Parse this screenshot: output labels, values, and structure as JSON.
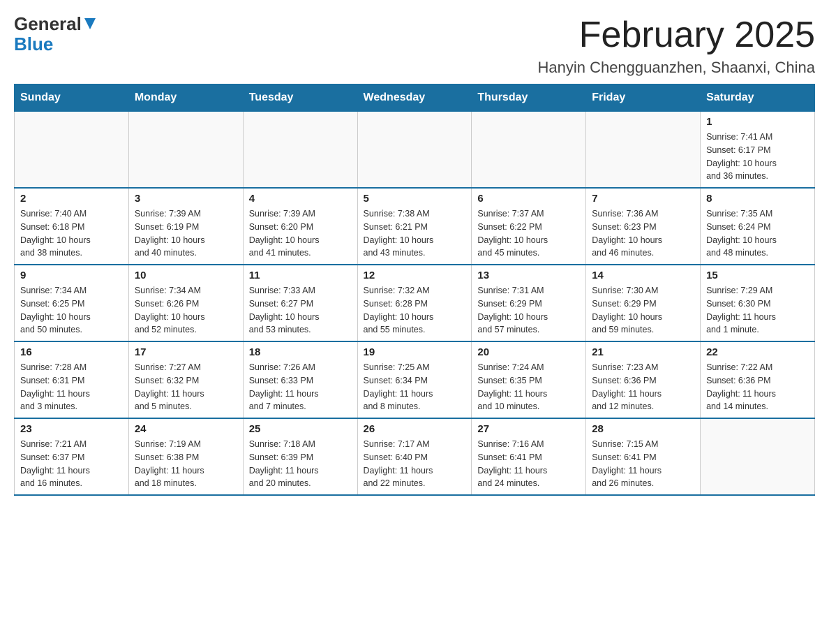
{
  "header": {
    "logo": {
      "general": "General",
      "blue": "Blue"
    },
    "title": "February 2025",
    "subtitle": "Hanyin Chengguanzhen, Shaanxi, China"
  },
  "calendar": {
    "days_of_week": [
      "Sunday",
      "Monday",
      "Tuesday",
      "Wednesday",
      "Thursday",
      "Friday",
      "Saturday"
    ],
    "weeks": [
      [
        {
          "day": "",
          "info": ""
        },
        {
          "day": "",
          "info": ""
        },
        {
          "day": "",
          "info": ""
        },
        {
          "day": "",
          "info": ""
        },
        {
          "day": "",
          "info": ""
        },
        {
          "day": "",
          "info": ""
        },
        {
          "day": "1",
          "info": "Sunrise: 7:41 AM\nSunset: 6:17 PM\nDaylight: 10 hours\nand 36 minutes."
        }
      ],
      [
        {
          "day": "2",
          "info": "Sunrise: 7:40 AM\nSunset: 6:18 PM\nDaylight: 10 hours\nand 38 minutes."
        },
        {
          "day": "3",
          "info": "Sunrise: 7:39 AM\nSunset: 6:19 PM\nDaylight: 10 hours\nand 40 minutes."
        },
        {
          "day": "4",
          "info": "Sunrise: 7:39 AM\nSunset: 6:20 PM\nDaylight: 10 hours\nand 41 minutes."
        },
        {
          "day": "5",
          "info": "Sunrise: 7:38 AM\nSunset: 6:21 PM\nDaylight: 10 hours\nand 43 minutes."
        },
        {
          "day": "6",
          "info": "Sunrise: 7:37 AM\nSunset: 6:22 PM\nDaylight: 10 hours\nand 45 minutes."
        },
        {
          "day": "7",
          "info": "Sunrise: 7:36 AM\nSunset: 6:23 PM\nDaylight: 10 hours\nand 46 minutes."
        },
        {
          "day": "8",
          "info": "Sunrise: 7:35 AM\nSunset: 6:24 PM\nDaylight: 10 hours\nand 48 minutes."
        }
      ],
      [
        {
          "day": "9",
          "info": "Sunrise: 7:34 AM\nSunset: 6:25 PM\nDaylight: 10 hours\nand 50 minutes."
        },
        {
          "day": "10",
          "info": "Sunrise: 7:34 AM\nSunset: 6:26 PM\nDaylight: 10 hours\nand 52 minutes."
        },
        {
          "day": "11",
          "info": "Sunrise: 7:33 AM\nSunset: 6:27 PM\nDaylight: 10 hours\nand 53 minutes."
        },
        {
          "day": "12",
          "info": "Sunrise: 7:32 AM\nSunset: 6:28 PM\nDaylight: 10 hours\nand 55 minutes."
        },
        {
          "day": "13",
          "info": "Sunrise: 7:31 AM\nSunset: 6:29 PM\nDaylight: 10 hours\nand 57 minutes."
        },
        {
          "day": "14",
          "info": "Sunrise: 7:30 AM\nSunset: 6:29 PM\nDaylight: 10 hours\nand 59 minutes."
        },
        {
          "day": "15",
          "info": "Sunrise: 7:29 AM\nSunset: 6:30 PM\nDaylight: 11 hours\nand 1 minute."
        }
      ],
      [
        {
          "day": "16",
          "info": "Sunrise: 7:28 AM\nSunset: 6:31 PM\nDaylight: 11 hours\nand 3 minutes."
        },
        {
          "day": "17",
          "info": "Sunrise: 7:27 AM\nSunset: 6:32 PM\nDaylight: 11 hours\nand 5 minutes."
        },
        {
          "day": "18",
          "info": "Sunrise: 7:26 AM\nSunset: 6:33 PM\nDaylight: 11 hours\nand 7 minutes."
        },
        {
          "day": "19",
          "info": "Sunrise: 7:25 AM\nSunset: 6:34 PM\nDaylight: 11 hours\nand 8 minutes."
        },
        {
          "day": "20",
          "info": "Sunrise: 7:24 AM\nSunset: 6:35 PM\nDaylight: 11 hours\nand 10 minutes."
        },
        {
          "day": "21",
          "info": "Sunrise: 7:23 AM\nSunset: 6:36 PM\nDaylight: 11 hours\nand 12 minutes."
        },
        {
          "day": "22",
          "info": "Sunrise: 7:22 AM\nSunset: 6:36 PM\nDaylight: 11 hours\nand 14 minutes."
        }
      ],
      [
        {
          "day": "23",
          "info": "Sunrise: 7:21 AM\nSunset: 6:37 PM\nDaylight: 11 hours\nand 16 minutes."
        },
        {
          "day": "24",
          "info": "Sunrise: 7:19 AM\nSunset: 6:38 PM\nDaylight: 11 hours\nand 18 minutes."
        },
        {
          "day": "25",
          "info": "Sunrise: 7:18 AM\nSunset: 6:39 PM\nDaylight: 11 hours\nand 20 minutes."
        },
        {
          "day": "26",
          "info": "Sunrise: 7:17 AM\nSunset: 6:40 PM\nDaylight: 11 hours\nand 22 minutes."
        },
        {
          "day": "27",
          "info": "Sunrise: 7:16 AM\nSunset: 6:41 PM\nDaylight: 11 hours\nand 24 minutes."
        },
        {
          "day": "28",
          "info": "Sunrise: 7:15 AM\nSunset: 6:41 PM\nDaylight: 11 hours\nand 26 minutes."
        },
        {
          "day": "",
          "info": ""
        }
      ]
    ]
  }
}
